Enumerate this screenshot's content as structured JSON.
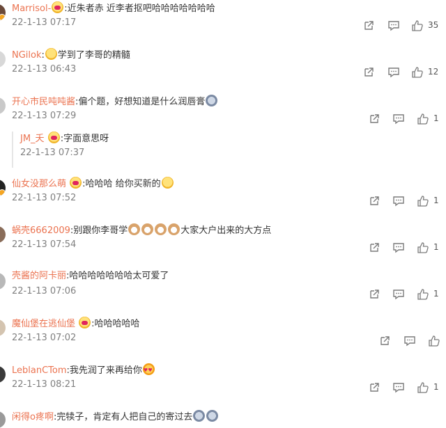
{
  "icon_names": {
    "share": "share-icon",
    "comment": "comment-icon",
    "like": "thumbs-up-icon"
  },
  "colors": {
    "username": "#eb7350",
    "text": "#333333",
    "timestamp": "#808080",
    "icon": "#7a7a7a",
    "background": "#ffffff"
  },
  "comments": [
    {
      "user": "Marrisol-",
      "text_a": ":近朱者赤 近李者抠吧哈哈哈哈哈哈哈",
      "text_b": "",
      "time": "22-1-13 07:17",
      "likes": "35"
    },
    {
      "user": "NGilok",
      "text_a": ":",
      "text_b": "学到了李哥的精髓",
      "time": "22-1-13 06:43",
      "likes": "12"
    },
    {
      "user": "开心市民吨吨酱",
      "text_a": ":偏个题，好想知道是什么润唇膏",
      "text_b": "",
      "time": "22-1-13 07:29",
      "likes": ""
    },
    {
      "user": "仙女没那么萌",
      "text_a": ":哈哈哈 给你买新的",
      "text_b": "",
      "time": "22-1-13 07:52",
      "likes": ""
    },
    {
      "user": "蜗壳6662009",
      "text_a": ":别跟你李哥学",
      "text_b": "大家大户出来的大方点",
      "time": "22-1-13 07:54",
      "likes": ""
    },
    {
      "user": "壳酱的阿卡丽",
      "text_a": ":哈哈哈哈哈哈哈太可爱了",
      "text_b": "",
      "time": "22-1-13 07:06",
      "likes": ""
    },
    {
      "user": "魔仙堡在逃仙堡",
      "text_a": ":哈哈哈哈哈",
      "text_b": "",
      "time": "22-1-13 07:02",
      "likes": ""
    },
    {
      "user": "LeblanCTom",
      "text_a": ":我先润了来再给你",
      "text_b": "",
      "time": "22-1-13 08:21",
      "likes": ""
    },
    {
      "user": "闲得o疼啊",
      "text_a": ":完犊子，肯定有人把自己的寄过去",
      "text_b": "",
      "time": "",
      "likes": ""
    }
  ],
  "reply": {
    "user": "JM_夭",
    "text": ":字面意思呀",
    "time": "22-1-13 07:37"
  },
  "like_placeholder": "1"
}
